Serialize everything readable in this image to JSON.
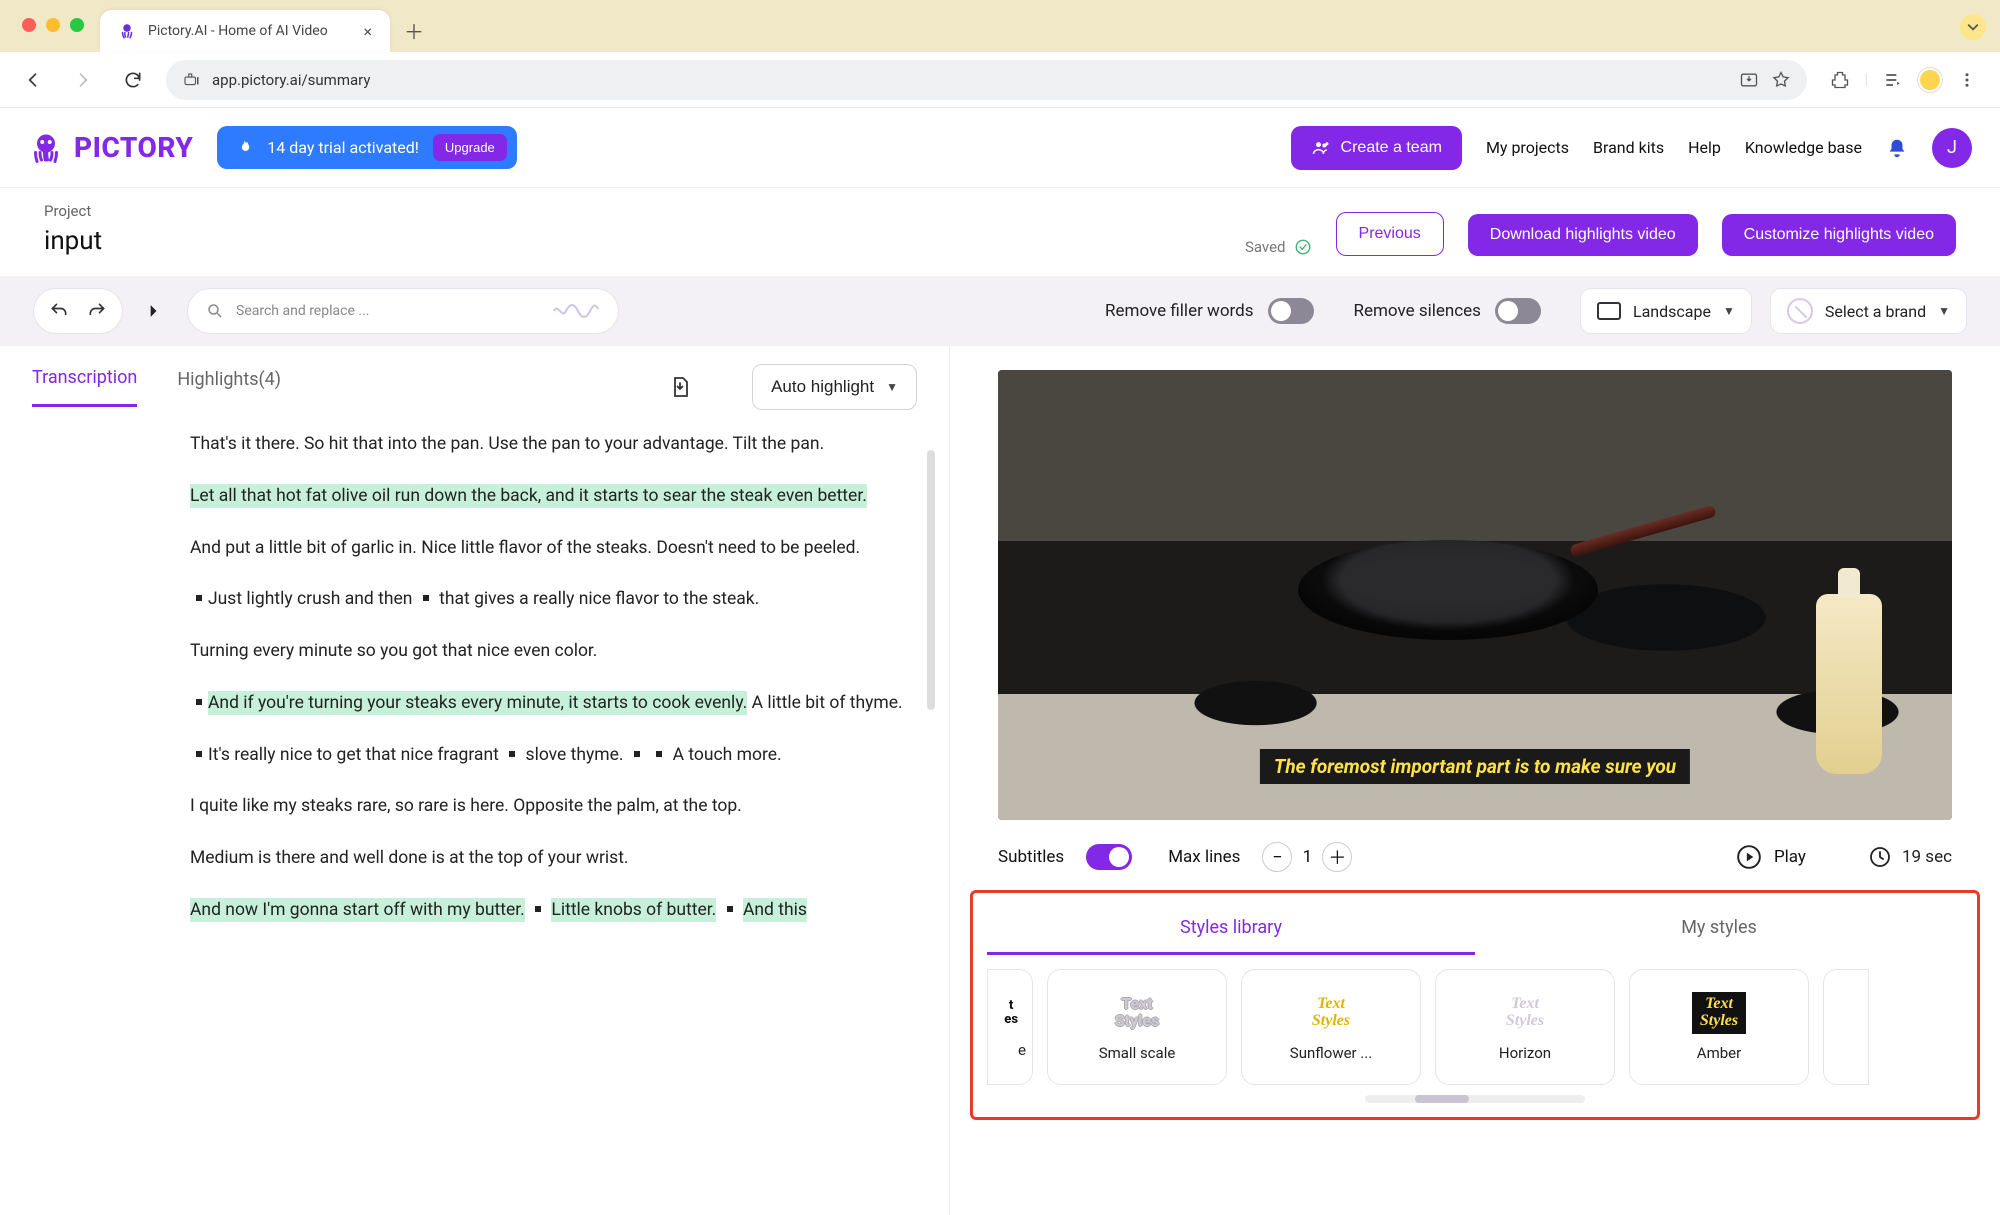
{
  "browser": {
    "tab_title": "Pictory.AI - Home of AI Video",
    "url": "app.pictory.ai/summary"
  },
  "appHeader": {
    "logo_text": "PICTORY",
    "trial_text": "14 day trial activated!",
    "upgrade_label": "Upgrade",
    "create_team_label": "Create a team",
    "nav": {
      "projects": "My projects",
      "brandkits": "Brand kits",
      "help": "Help",
      "knowledge": "Knowledge base"
    },
    "avatar_initial": "J"
  },
  "projectBar": {
    "label": "Project",
    "name": "input",
    "saved_text": "Saved",
    "previous_label": "Previous",
    "download_label": "Download highlights video",
    "customize_label": "Customize highlights video"
  },
  "toolbar": {
    "search_placeholder": "Search and replace ...",
    "remove_filler_label": "Remove filler words",
    "remove_silences_label": "Remove silences",
    "orientation_label": "Landscape",
    "brand_label": "Select a brand"
  },
  "editorTabs": {
    "transcription_label": "Transcription",
    "highlights_label": "Highlights(4)",
    "auto_highlight_label": "Auto highlight"
  },
  "transcript": {
    "p1": "That's it there. So hit that into the pan. Use the pan to your advantage. Tilt the pan.",
    "p2_hl": "Let all that hot fat olive oil run down the back, and it starts to sear the steak even better.",
    "p3": "And put a little bit of garlic in. Nice little flavor of the steaks. Doesn't need to be peeled.",
    "p4a": "Just lightly crush and then",
    "p4b": "that gives a really nice flavor to the steak.",
    "p5": "Turning every minute so you got that nice even color.",
    "p6_hl": "And if you're turning your steaks every minute, it starts to cook evenly.",
    "p6_tail": " A little bit of thyme.",
    "p7a": "It's really nice to get that nice fragrant",
    "p7b": "slove thyme.",
    "p7c": "A touch more.",
    "p8": "I quite like my steaks rare, so rare is here. Opposite the palm, at the top.",
    "p9": "Medium is there and well done is at the top of your wrist.",
    "p10a_hl": "And now I'm gonna start off with my butter.",
    "p10b_hl": "Little knobs of butter.",
    "p10c_hl": "And this"
  },
  "preview": {
    "caption": "The foremost important part is to make sure you"
  },
  "subtitlesRow": {
    "subtitles_label": "Subtitles",
    "maxlines_label": "Max lines",
    "maxlines_value": "1",
    "play_label": "Play",
    "duration_text": "19 sec"
  },
  "styles": {
    "library_tab": "Styles library",
    "mystyles_tab": "My styles",
    "swatch_text": "Text\nStyles",
    "cards": [
      {
        "name_fragment": "e"
      },
      {
        "name": "Small scale"
      },
      {
        "name": "Sunflower ..."
      },
      {
        "name": "Horizon"
      },
      {
        "name": "Amber"
      }
    ]
  }
}
